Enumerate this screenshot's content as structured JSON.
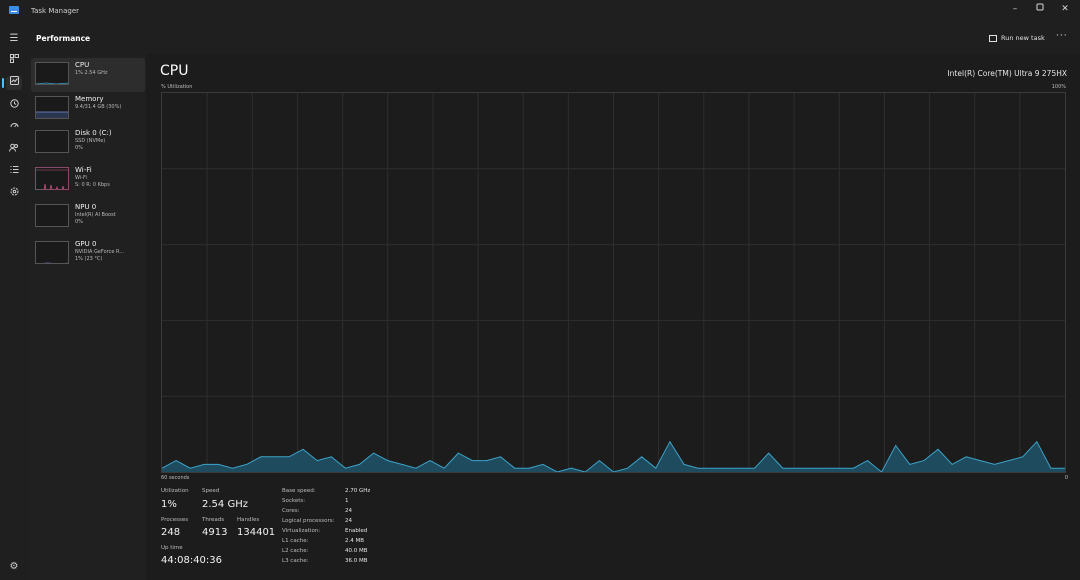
{
  "window": {
    "title": "Task Manager"
  },
  "header": {
    "page_title": "Performance",
    "run_new_task": "Run new task",
    "more": "···"
  },
  "devices": [
    {
      "name": "CPU",
      "sub1": "1%  2.54 GHz",
      "sub2": ""
    },
    {
      "name": "Memory",
      "sub1": "9.4/31.4 GB (30%)",
      "sub2": ""
    },
    {
      "name": "Disk 0 (C:)",
      "sub1": "SSD (NVMe)",
      "sub2": "0%"
    },
    {
      "name": "Wi-Fi",
      "sub1": "Wi-Fi",
      "sub2": "S: 0  R: 0 Kbps"
    },
    {
      "name": "NPU 0",
      "sub1": "Intel(R) AI Boost",
      "sub2": "0%"
    },
    {
      "name": "GPU 0",
      "sub1": "NVIDIA GeForce R...",
      "sub2": "1%  (23 °C)"
    }
  ],
  "main": {
    "title": "CPU",
    "model": "Intel(R) Core(TM) Ultra 9 275HX",
    "util_label": "% Utilization",
    "max_label": "100%",
    "time_label": "60 seconds",
    "zero_label": "0"
  },
  "stats": {
    "utilization_label": "Utilization",
    "utilization": "1%",
    "speed_label": "Speed",
    "speed": "2.54 GHz",
    "processes_label": "Processes",
    "processes": "248",
    "threads_label": "Threads",
    "threads": "4913",
    "handles_label": "Handles",
    "handles": "134401",
    "uptime_label": "Up time",
    "uptime": "44:08:40:36"
  },
  "specs": [
    {
      "label": "Base speed:",
      "value": "2.70 GHz"
    },
    {
      "label": "Sockets:",
      "value": "1"
    },
    {
      "label": "Cores:",
      "value": "24"
    },
    {
      "label": "Logical processors:",
      "value": "24"
    },
    {
      "label": "Virtualization:",
      "value": "Enabled"
    },
    {
      "label": "L1 cache:",
      "value": "2.4 MB"
    },
    {
      "label": "L2 cache:",
      "value": "40.0 MB"
    },
    {
      "label": "L3 cache:",
      "value": "36.0 MB"
    }
  ],
  "colors": {
    "cpu_line": "#3ba3c9",
    "cpu_fill": "#1f4b5e",
    "grid": "#2e2e2e",
    "accent": "#4cc2ff"
  },
  "chart_data": {
    "type": "area",
    "x_range": [
      60,
      0
    ],
    "ylim": [
      0,
      100
    ],
    "values": [
      1,
      3,
      1,
      2,
      2,
      1,
      2,
      4,
      4,
      4,
      6,
      3,
      4,
      1,
      2,
      5,
      3,
      2,
      1,
      3,
      1,
      5,
      3,
      3,
      4,
      1,
      1,
      2,
      0,
      1,
      0,
      3,
      0,
      1,
      4,
      1,
      8,
      2,
      1,
      1,
      1,
      1,
      1,
      5,
      1,
      1,
      1,
      1,
      1,
      1,
      3,
      0,
      7,
      2,
      3,
      6,
      2,
      4,
      3,
      2,
      3,
      4,
      8,
      1,
      1
    ]
  }
}
